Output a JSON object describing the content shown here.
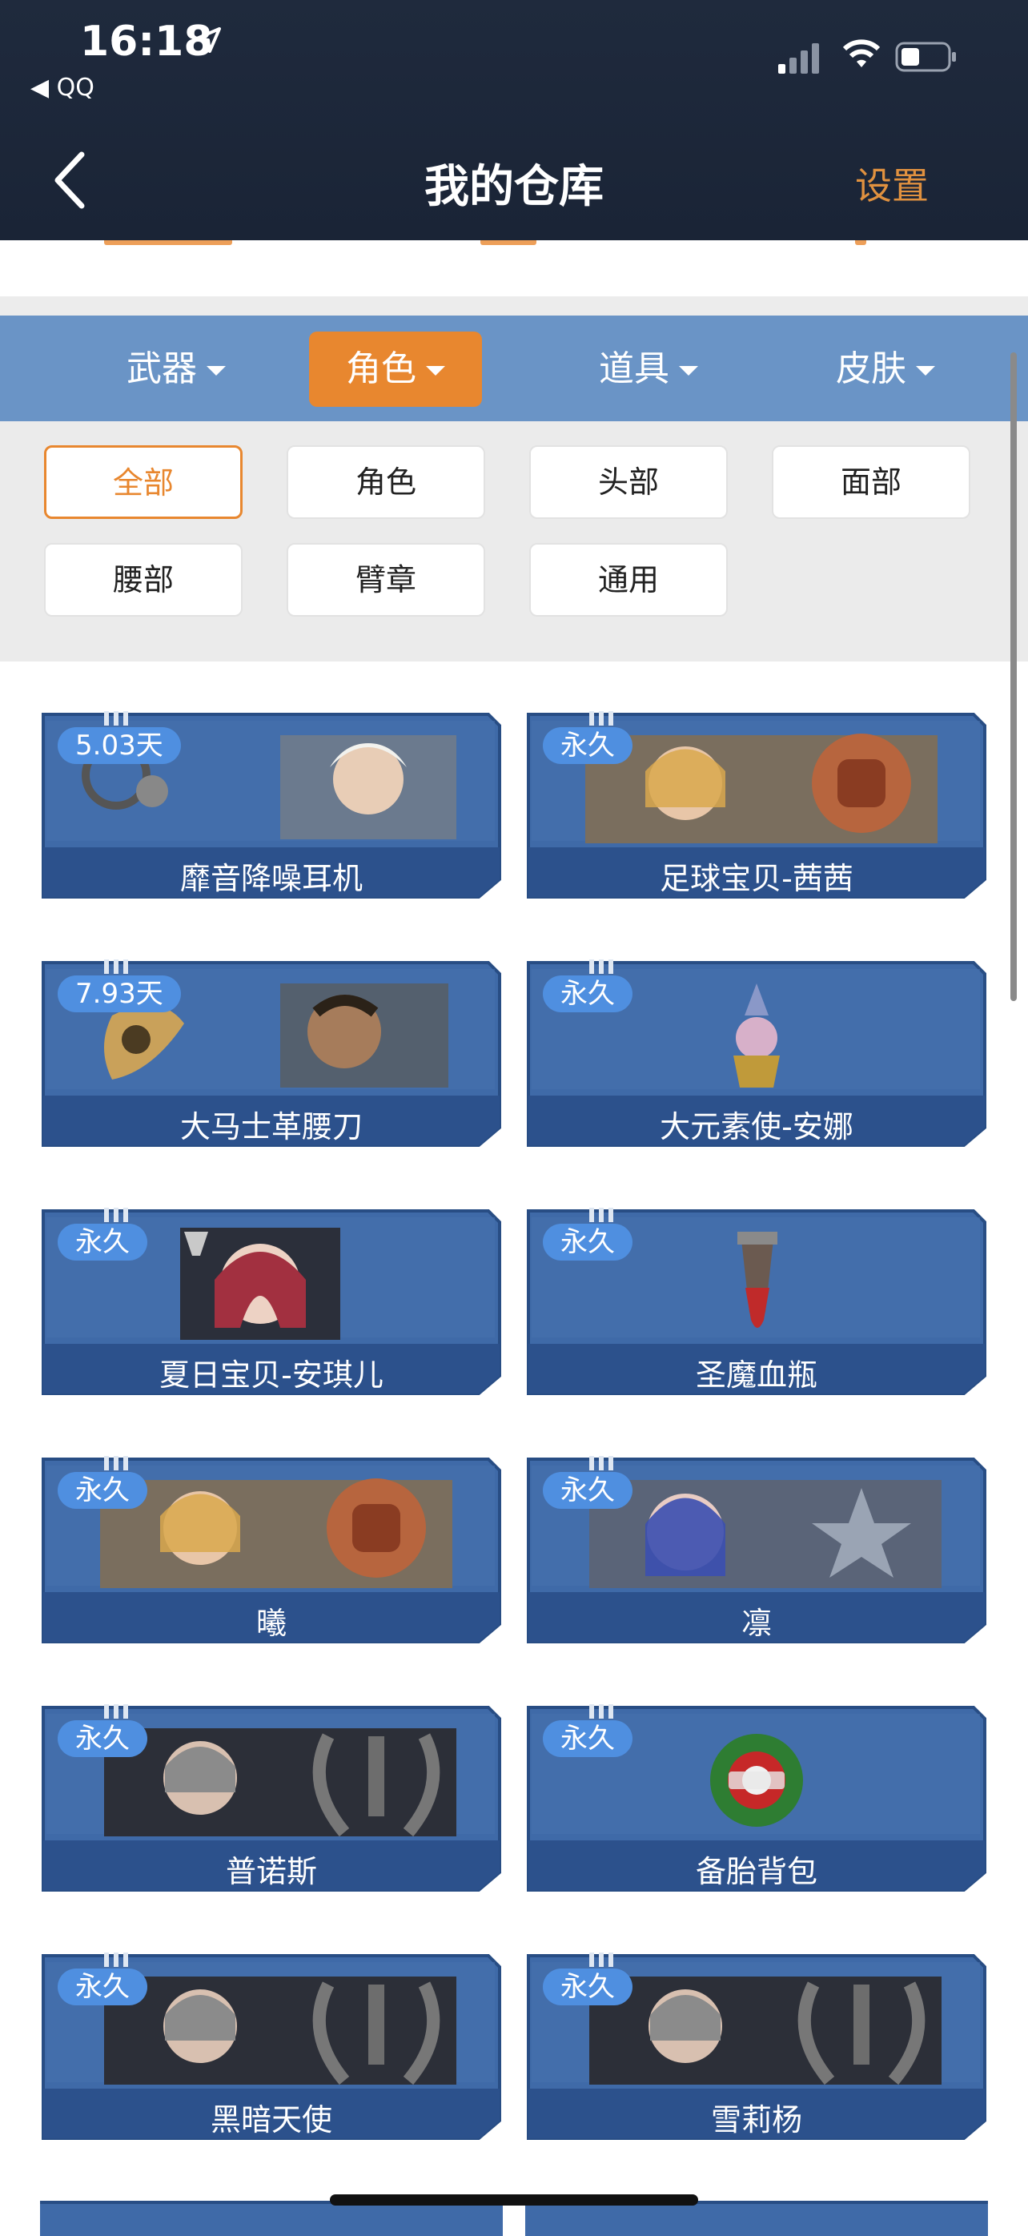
{
  "status_bar": {
    "time": "16:18",
    "back_app": "◀ QQ"
  },
  "nav": {
    "title": "我的仓库",
    "settings_label": "设置"
  },
  "tabs": [
    {
      "label": "武器",
      "active": false
    },
    {
      "label": "角色",
      "active": true
    },
    {
      "label": "道具",
      "active": false
    },
    {
      "label": "皮肤",
      "active": false
    }
  ],
  "filters": [
    {
      "label": "全部",
      "active": true
    },
    {
      "label": "角色",
      "active": false
    },
    {
      "label": "头部",
      "active": false
    },
    {
      "label": "面部",
      "active": false
    },
    {
      "label": "腰部",
      "active": false
    },
    {
      "label": "臂章",
      "active": false
    },
    {
      "label": "通用",
      "active": false
    }
  ],
  "items": [
    {
      "badge": "5.03天",
      "name": "靡音降噪耳机",
      "art": "headphones-and-portrait"
    },
    {
      "badge": "永久",
      "name": "足球宝贝-茜茜",
      "art": "portrait-with-fist"
    },
    {
      "badge": "7.93天",
      "name": "大马士革腰刀",
      "art": "knife-and-portrait"
    },
    {
      "badge": "永久",
      "name": "大元素使-安娜",
      "art": "small-figure"
    },
    {
      "badge": "永久",
      "name": "夏日宝贝-安琪儿",
      "art": "portrait"
    },
    {
      "badge": "永久",
      "name": "圣魔血瓶",
      "art": "vial"
    },
    {
      "badge": "永久",
      "name": "曦",
      "art": "portrait-with-fist"
    },
    {
      "badge": "永久",
      "name": "凛",
      "art": "portrait-with-star"
    },
    {
      "badge": "永久",
      "name": "普诺斯",
      "art": "portrait-with-wreath"
    },
    {
      "badge": "永久",
      "name": "备胎背包",
      "art": "tire-bag"
    },
    {
      "badge": "永久",
      "name": "黑暗天使",
      "art": "portrait-with-wreath"
    },
    {
      "badge": "永久",
      "name": "雪莉杨",
      "art": "portrait-with-wreath"
    }
  ],
  "colors": {
    "accent": "#e8872f",
    "tab_bar": "#6a94c6",
    "card": "#3f6aa8",
    "badge": "#4f8fe0"
  }
}
